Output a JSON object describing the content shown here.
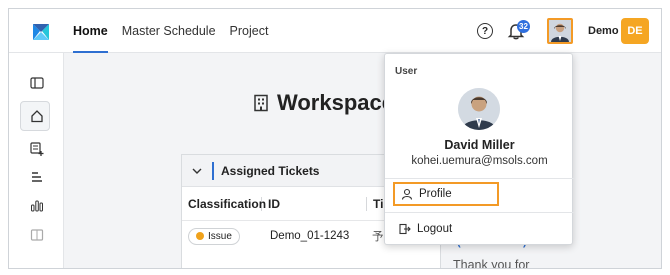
{
  "topbar": {
    "tabs": [
      {
        "label": "Home",
        "active": true
      },
      {
        "label": "Master Schedule",
        "active": false
      },
      {
        "label": "Project",
        "active": false
      }
    ],
    "help_glyph": "?",
    "notification_count": "32",
    "user_label": "Demo",
    "user_initials": "DE"
  },
  "workspace": {
    "title": "Workspace"
  },
  "tickets_panel": {
    "title": "Assigned Tickets",
    "columns": [
      "Classification",
      "ID",
      "Ti"
    ],
    "rows": [
      {
        "classification": "Issue",
        "id": "Demo_01-1243",
        "title": "予定の入"
      }
    ]
  },
  "side_card": {
    "heading_fragment": "(December 1)",
    "text": "Thank you for"
  },
  "user_menu": {
    "section_label": "User",
    "name": "David Miller",
    "email": "kohei.uemura@msols.com",
    "items": [
      {
        "label": "Profile",
        "icon": "person-icon"
      },
      {
        "label": "Logout",
        "icon": "logout-icon"
      }
    ]
  },
  "colors": {
    "accent": "#2e6fd1",
    "highlight": "#f39a26",
    "initials_bg": "#f5a623",
    "badge": "#2f6fde"
  }
}
